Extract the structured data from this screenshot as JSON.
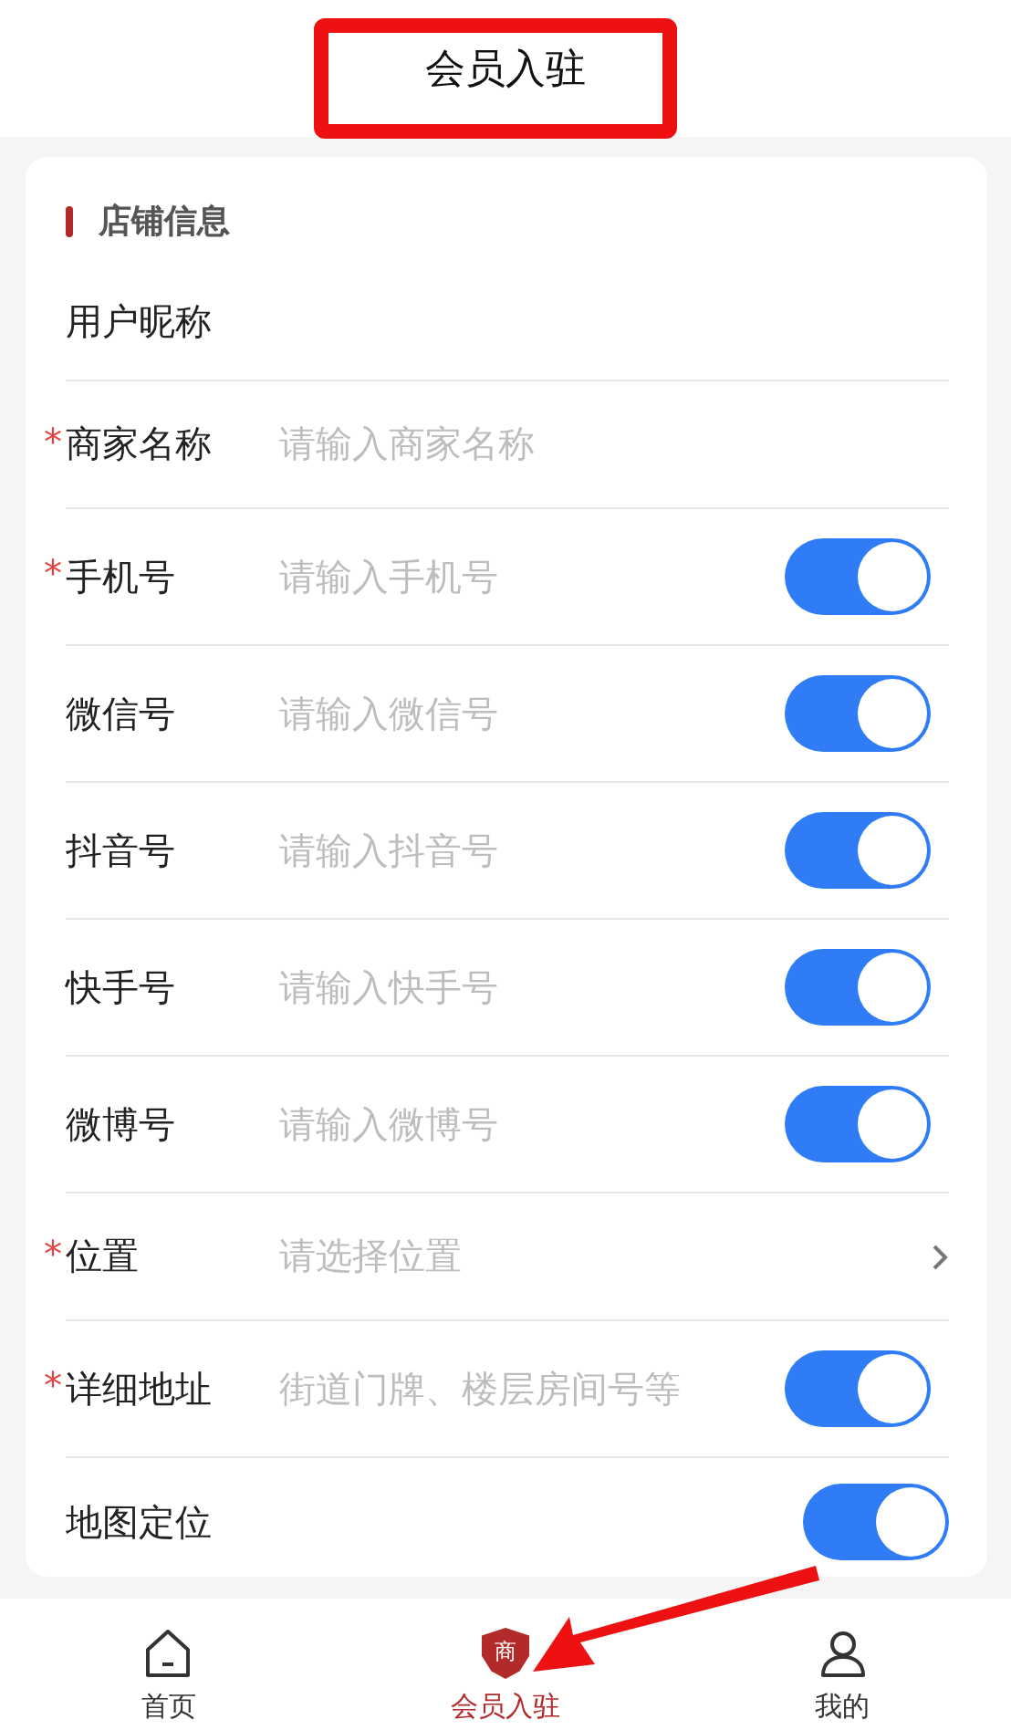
{
  "header": {
    "title": "会员入驻"
  },
  "section": {
    "title": "店铺信息"
  },
  "required_mark": "*",
  "rows": [
    {
      "kind": "text",
      "label": "用户昵称",
      "required": false
    },
    {
      "kind": "input",
      "label": "商家名称",
      "required": true,
      "placeholder": "请输入商家名称"
    },
    {
      "kind": "input",
      "label": "手机号",
      "required": true,
      "placeholder": "请输入手机号",
      "toggle": {
        "on": true
      }
    },
    {
      "kind": "input",
      "label": "微信号",
      "required": false,
      "placeholder": "请输入微信号",
      "toggle": {
        "on": true
      }
    },
    {
      "kind": "input",
      "label": "抖音号",
      "required": false,
      "placeholder": "请输入抖音号",
      "toggle": {
        "on": true
      }
    },
    {
      "kind": "input",
      "label": "快手号",
      "required": false,
      "placeholder": "请输入快手号",
      "toggle": {
        "on": true
      }
    },
    {
      "kind": "input",
      "label": "微博号",
      "required": false,
      "placeholder": "请输入微博号",
      "toggle": {
        "on": true
      }
    },
    {
      "kind": "select",
      "label": "位置",
      "required": true,
      "placeholder": "请选择位置"
    },
    {
      "kind": "input",
      "label": "详细地址",
      "required": true,
      "placeholder": "街道门牌、楼层房间号等",
      "toggle": {
        "on": true
      }
    },
    {
      "kind": "text",
      "label": "地图定位",
      "required": false,
      "toggle": {
        "on": true
      }
    }
  ],
  "tabs": [
    {
      "kind": "home",
      "label": "首页",
      "selected": false
    },
    {
      "kind": "shield",
      "label": "会员入驻",
      "badge": "商",
      "selected": true
    },
    {
      "kind": "person",
      "label": "我的",
      "selected": false
    }
  ]
}
